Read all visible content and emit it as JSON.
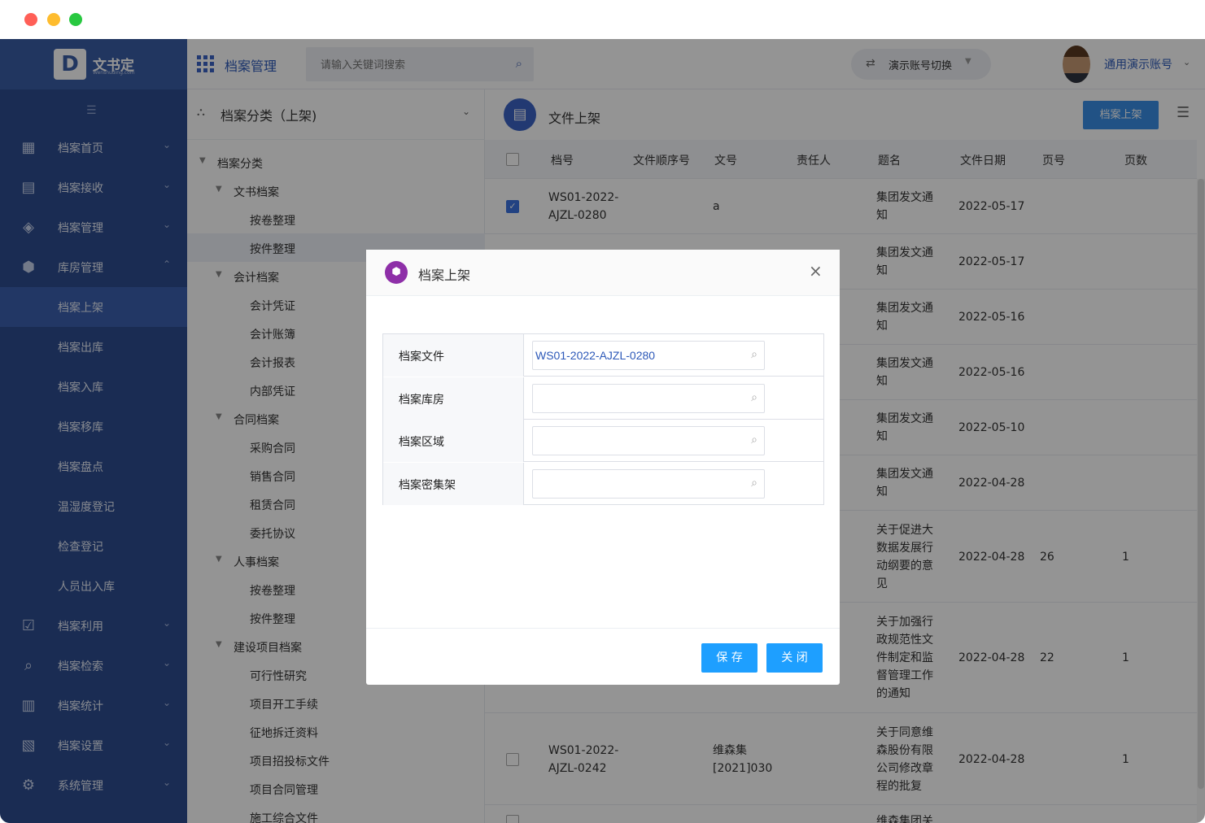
{
  "window": {
    "dots": [
      "#ff5f57",
      "#febc2e",
      "#28c840"
    ]
  },
  "brand": {
    "mark": "D",
    "name": "文书定",
    "sub": "Wenshuding.com"
  },
  "sidebar": {
    "items": [
      {
        "label": "档案首页",
        "icon": "dashboard-icon",
        "glyph": "▦",
        "chev": "⌄"
      },
      {
        "label": "档案接收",
        "icon": "receive-icon",
        "glyph": "▤",
        "chev": "⌄"
      },
      {
        "label": "档案管理",
        "icon": "layers-icon",
        "glyph": "◈",
        "chev": "⌄"
      },
      {
        "label": "库房管理",
        "icon": "box-icon",
        "glyph": "⬢",
        "chev": "⌃"
      },
      {
        "label": "档案上架"
      },
      {
        "label": "档案出库"
      },
      {
        "label": "档案入库"
      },
      {
        "label": "档案移库"
      },
      {
        "label": "档案盘点"
      },
      {
        "label": "温湿度登记"
      },
      {
        "label": "检查登记"
      },
      {
        "label": "人员出入库"
      },
      {
        "label": "档案利用",
        "icon": "checklist-icon",
        "glyph": "☑",
        "chev": "⌄"
      },
      {
        "label": "档案检索",
        "icon": "search-doc-icon",
        "glyph": "⌕",
        "chev": "⌄"
      },
      {
        "label": "档案统计",
        "icon": "bar-chart-icon",
        "glyph": "▥",
        "chev": "⌄"
      },
      {
        "label": "档案设置",
        "icon": "doc-settings-icon",
        "glyph": "▧",
        "chev": "⌄"
      },
      {
        "label": "系统管理",
        "icon": "gear-icon",
        "glyph": "⚙",
        "chev": "⌄"
      }
    ]
  },
  "topbar": {
    "title": "档案管理",
    "search_placeholder": "请输入关键词搜索",
    "switch_label": "演示账号切换",
    "user_name": "通用演示账号"
  },
  "tree": {
    "header": "档案分类（上架)",
    "nodes": [
      {
        "label": "档案分类",
        "level": 0,
        "caret": "▼"
      },
      {
        "label": "文书档案",
        "level": 1,
        "caret": "▼"
      },
      {
        "label": "按卷整理",
        "level": 2
      },
      {
        "label": "按件整理",
        "level": 2,
        "selected": true
      },
      {
        "label": "会计档案",
        "level": 1,
        "caret": "▼"
      },
      {
        "label": "会计凭证",
        "level": 2
      },
      {
        "label": "会计账簿",
        "level": 2
      },
      {
        "label": "会计报表",
        "level": 2
      },
      {
        "label": "内部凭证",
        "level": 2
      },
      {
        "label": "合同档案",
        "level": 1,
        "caret": "▼"
      },
      {
        "label": "采购合同",
        "level": 2
      },
      {
        "label": "销售合同",
        "level": 2
      },
      {
        "label": "租赁合同",
        "level": 2
      },
      {
        "label": "委托协议",
        "level": 2
      },
      {
        "label": "人事档案",
        "level": 1,
        "caret": "▼"
      },
      {
        "label": "按卷整理",
        "level": 2
      },
      {
        "label": "按件整理",
        "level": 2
      },
      {
        "label": "建设项目档案",
        "level": 1,
        "caret": "▼"
      },
      {
        "label": "可行性研究",
        "level": 2
      },
      {
        "label": "项目开工手续",
        "level": 2
      },
      {
        "label": "征地拆迁资料",
        "level": 2
      },
      {
        "label": "项目招投标文件",
        "level": 2
      },
      {
        "label": "项目合同管理",
        "level": 2
      },
      {
        "label": "施工综合文件",
        "level": 2
      }
    ]
  },
  "main": {
    "title": "文件上架",
    "shelf_button": "档案上架",
    "columns": [
      "档号",
      "文件顺序号",
      "文号",
      "责任人",
      "题名",
      "文件日期",
      "页号",
      "页数"
    ],
    "rows": [
      {
        "checked": true,
        "dh": "WS01-2022-\nAJZL-0280",
        "wh": "a",
        "tm": "集团发文通\n知",
        "date": "2022-05-17",
        "yh": "",
        "ys": ""
      },
      {
        "checked": false,
        "dh": "",
        "wh": "",
        "tm": "集团发文通\n知",
        "date": "2022-05-17",
        "yh": "",
        "ys": ""
      },
      {
        "checked": false,
        "dh": "",
        "wh": "",
        "tm": "集团发文通\n知",
        "date": "2022-05-16",
        "yh": "",
        "ys": ""
      },
      {
        "checked": false,
        "dh": "",
        "wh": "",
        "tm": "集团发文通\n知",
        "date": "2022-05-16",
        "yh": "",
        "ys": ""
      },
      {
        "checked": false,
        "dh": "",
        "wh": "",
        "tm": "集团发文通\n知",
        "date": "2022-05-10",
        "yh": "",
        "ys": ""
      },
      {
        "checked": false,
        "dh": "",
        "wh": "",
        "tm": "集团发文通\n知",
        "date": "2022-04-28",
        "yh": "",
        "ys": ""
      },
      {
        "checked": false,
        "dh": "",
        "wh": "",
        "tm": "关于促进大\n数据发展行\n动纲要的意\n见",
        "date": "2022-04-28",
        "yh": "26",
        "ys": "1"
      },
      {
        "checked": false,
        "dh": "",
        "wh": "",
        "tm": "关于加强行\n政规范性文\n件制定和监\n督管理工作\n的通知",
        "date": "2022-04-28",
        "yh": "22",
        "ys": "1"
      },
      {
        "checked": false,
        "dh": "WS01-2022-\nAJZL-0242",
        "wh": "维森集\n[2021]030",
        "tm": "关于同意维\n森股份有限\n公司修改章\n程的批复",
        "date": "2022-04-28",
        "yh": "",
        "ys": "1"
      },
      {
        "checked": false,
        "dh": "",
        "wh": "",
        "tm": "维森集团关",
        "date": "",
        "yh": "",
        "ys": ""
      }
    ]
  },
  "modal": {
    "title": "档案上架",
    "close": "×",
    "fields": [
      {
        "label": "档案文件",
        "value": "WS01-2022-AJZL-0280"
      },
      {
        "label": "档案库房",
        "value": ""
      },
      {
        "label": "档案区域",
        "value": ""
      },
      {
        "label": "档案密集架",
        "value": ""
      }
    ],
    "save": "保 存",
    "cancel": "关 闭"
  },
  "colors": {
    "primary": "#3a8ee6",
    "modal_button": "#1e9fff",
    "sidebar": "#2e4d8f",
    "cube": "#8e2fa8"
  }
}
